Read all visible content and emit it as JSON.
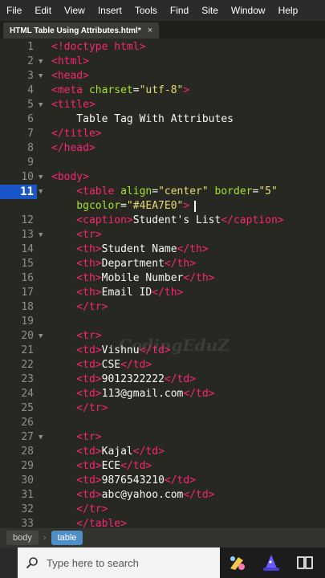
{
  "menu": [
    "File",
    "Edit",
    "View",
    "Insert",
    "Tools",
    "Find",
    "Site",
    "Window",
    "Help"
  ],
  "tab": {
    "label": "HTML Table Using Attributes.html*",
    "close": "×"
  },
  "watermark": "CodingEduZ",
  "code_lines": [
    {
      "n": "1",
      "fold": "",
      "segs": [
        [
          "t",
          "<!doctype html>"
        ]
      ]
    },
    {
      "n": "2",
      "fold": "▼",
      "segs": [
        [
          "t",
          "<html>"
        ]
      ]
    },
    {
      "n": "3",
      "fold": "▼",
      "segs": [
        [
          "t",
          "<head>"
        ]
      ]
    },
    {
      "n": "4",
      "fold": "",
      "segs": [
        [
          "t",
          "<meta "
        ],
        [
          "a",
          "charset"
        ],
        [
          "p",
          "="
        ],
        [
          "s",
          "\"utf-8\""
        ],
        [
          "t",
          ">"
        ]
      ]
    },
    {
      "n": "5",
      "fold": "▼",
      "segs": [
        [
          "t",
          "<title>"
        ]
      ]
    },
    {
      "n": "6",
      "fold": "",
      "segs": [
        [
          "p",
          "    Table Tag With Attributes"
        ]
      ]
    },
    {
      "n": "7",
      "fold": "",
      "segs": [
        [
          "t",
          "</title>"
        ]
      ]
    },
    {
      "n": "8",
      "fold": "",
      "segs": [
        [
          "t",
          "</head>"
        ]
      ]
    },
    {
      "n": "9",
      "fold": "",
      "segs": []
    },
    {
      "n": "10",
      "fold": "▼",
      "segs": [
        [
          "t",
          "<body>"
        ]
      ]
    },
    {
      "n": "11",
      "fold": "▼",
      "hl": true,
      "segs": [
        [
          "t",
          "    <table "
        ],
        [
          "a",
          "align"
        ],
        [
          "p",
          "="
        ],
        [
          "s",
          "\"center\""
        ],
        [
          "p",
          " "
        ],
        [
          "a",
          "border"
        ],
        [
          "p",
          "="
        ],
        [
          "s",
          "\"5\""
        ]
      ]
    },
    {
      "n": "",
      "fold": "",
      "segs": [
        [
          "a",
          "    bgcolor"
        ],
        [
          "p",
          "="
        ],
        [
          "s",
          "\"#4EA7E0\""
        ],
        [
          "t",
          ">"
        ]
      ],
      "cursor": true
    },
    {
      "n": "12",
      "fold": "",
      "segs": [
        [
          "t",
          "    <caption>"
        ],
        [
          "p",
          "Student's List"
        ],
        [
          "t",
          "</caption>"
        ]
      ]
    },
    {
      "n": "13",
      "fold": "▼",
      "segs": [
        [
          "t",
          "    <tr>"
        ]
      ]
    },
    {
      "n": "14",
      "fold": "",
      "segs": [
        [
          "t",
          "    <th>"
        ],
        [
          "p",
          "Student Name"
        ],
        [
          "t",
          "</th>"
        ]
      ]
    },
    {
      "n": "15",
      "fold": "",
      "segs": [
        [
          "t",
          "    <th>"
        ],
        [
          "p",
          "Department"
        ],
        [
          "t",
          "</th>"
        ]
      ]
    },
    {
      "n": "16",
      "fold": "",
      "segs": [
        [
          "t",
          "    <th>"
        ],
        [
          "p",
          "Mobile Number"
        ],
        [
          "t",
          "</th>"
        ]
      ]
    },
    {
      "n": "17",
      "fold": "",
      "segs": [
        [
          "t",
          "    <th>"
        ],
        [
          "p",
          "Email ID"
        ],
        [
          "t",
          "</th>"
        ]
      ]
    },
    {
      "n": "18",
      "fold": "",
      "segs": [
        [
          "t",
          "    </tr>"
        ]
      ]
    },
    {
      "n": "19",
      "fold": "",
      "segs": []
    },
    {
      "n": "20",
      "fold": "▼",
      "segs": [
        [
          "t",
          "    <tr>"
        ]
      ]
    },
    {
      "n": "21",
      "fold": "",
      "segs": [
        [
          "t",
          "    <td>"
        ],
        [
          "p",
          "Vishnu"
        ],
        [
          "t",
          "</td>"
        ]
      ]
    },
    {
      "n": "22",
      "fold": "",
      "segs": [
        [
          "t",
          "    <td>"
        ],
        [
          "p",
          "CSE"
        ],
        [
          "t",
          "</td>"
        ]
      ]
    },
    {
      "n": "23",
      "fold": "",
      "segs": [
        [
          "t",
          "    <td>"
        ],
        [
          "p",
          "9012322222"
        ],
        [
          "t",
          "</td>"
        ]
      ]
    },
    {
      "n": "24",
      "fold": "",
      "segs": [
        [
          "t",
          "    <td>"
        ],
        [
          "p",
          "113@gmail.com"
        ],
        [
          "t",
          "</td>"
        ]
      ]
    },
    {
      "n": "25",
      "fold": "",
      "segs": [
        [
          "t",
          "    </tr>"
        ]
      ]
    },
    {
      "n": "26",
      "fold": "",
      "segs": []
    },
    {
      "n": "27",
      "fold": "▼",
      "segs": [
        [
          "t",
          "    <tr>"
        ]
      ]
    },
    {
      "n": "28",
      "fold": "",
      "segs": [
        [
          "t",
          "    <td>"
        ],
        [
          "p",
          "Kajal"
        ],
        [
          "t",
          "</td>"
        ]
      ]
    },
    {
      "n": "29",
      "fold": "",
      "segs": [
        [
          "t",
          "    <td>"
        ],
        [
          "p",
          "ECE"
        ],
        [
          "t",
          "</td>"
        ]
      ]
    },
    {
      "n": "30",
      "fold": "",
      "segs": [
        [
          "t",
          "    <td>"
        ],
        [
          "p",
          "9876543210"
        ],
        [
          "t",
          "</td>"
        ]
      ]
    },
    {
      "n": "31",
      "fold": "",
      "segs": [
        [
          "t",
          "    <td>"
        ],
        [
          "p",
          "abc@yahoo.com"
        ],
        [
          "t",
          "</td>"
        ]
      ]
    },
    {
      "n": "32",
      "fold": "",
      "segs": [
        [
          "t",
          "    </tr>"
        ]
      ]
    },
    {
      "n": "33",
      "fold": "",
      "segs": [
        [
          "t",
          "    </table>"
        ]
      ]
    }
  ],
  "breadcrumbs": [
    "body",
    "table"
  ],
  "taskbar": {
    "search_placeholder": "Type here to search"
  },
  "icons": {
    "search": "search-icon",
    "app1": "paint-app-icon",
    "app2": "wizard-hat-icon",
    "app3": "task-view-icon"
  },
  "colors": {
    "accent": "#1a56c7",
    "crumb_active": "#4f8fc9",
    "tag": "#f92672",
    "attr": "#a6e22e",
    "string": "#e6db74"
  }
}
